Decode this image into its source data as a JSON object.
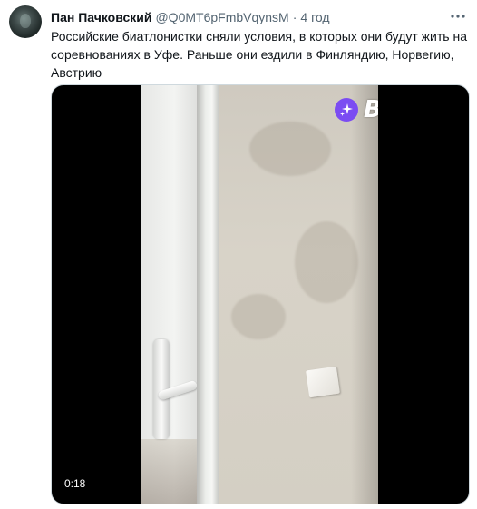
{
  "tweet": {
    "display_name": "Пан Пачковский",
    "handle": "@Q0MT6pFmbVqynsM",
    "separator": "·",
    "time": "4 год",
    "more_icon": "more-dots-icon",
    "text": "Российские биатлонистки сняли условия, в которых они будут жить на соревнованиях в Уфе. Раньше они ездили в Финляндию, Норвегию, Австрию"
  },
  "media": {
    "watermark_icon": "sparkle-icon",
    "watermark_text": "BAZA",
    "watermark_color": "#7b4cf2",
    "duration": "0:18"
  }
}
